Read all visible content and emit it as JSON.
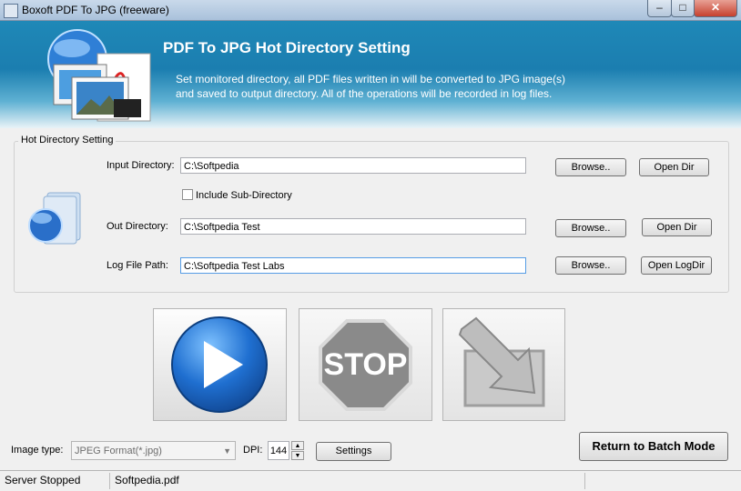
{
  "window": {
    "title": "Boxoft PDF To JPG (freeware)",
    "min_label": "–",
    "max_label": "□",
    "close_label": "✕"
  },
  "header": {
    "title": "PDF To JPG Hot Directory Setting",
    "desc_line1": "Set monitored directory, all PDF files written in will be converted to JPG image(s)",
    "desc_line2": "and saved to output directory. All of the operations will be recorded in log files."
  },
  "hot_dir": {
    "group_title": "Hot Directory Setting",
    "input_label": "Input Directory:",
    "input_value": "C:\\Softpedia",
    "include_sub_label": "Include Sub-Directory",
    "include_sub_checked": false,
    "out_label": "Out Directory:",
    "out_value": "C:\\Softpedia Test",
    "log_label": "Log File Path:",
    "log_value": "C:\\Softpedia Test Labs",
    "browse_label": "Browse..",
    "open_dir_label": "Open Dir",
    "open_logdir_label": "Open LogDir"
  },
  "actions": {
    "stop_label": "STOP"
  },
  "options": {
    "image_type_label": "Image type:",
    "image_type_value": "JPEG Format(*.jpg)",
    "dpi_label": "DPI:",
    "dpi_value": "144",
    "settings_label": "Settings",
    "batch_label": "Return to Batch Mode"
  },
  "status": {
    "state": "Server Stopped",
    "file": "Softpedia.pdf"
  },
  "colors": {
    "header_blue": "#1b7eb0",
    "play_blue": "#1f6fd0",
    "stop_gray": "#8a8a8a"
  }
}
